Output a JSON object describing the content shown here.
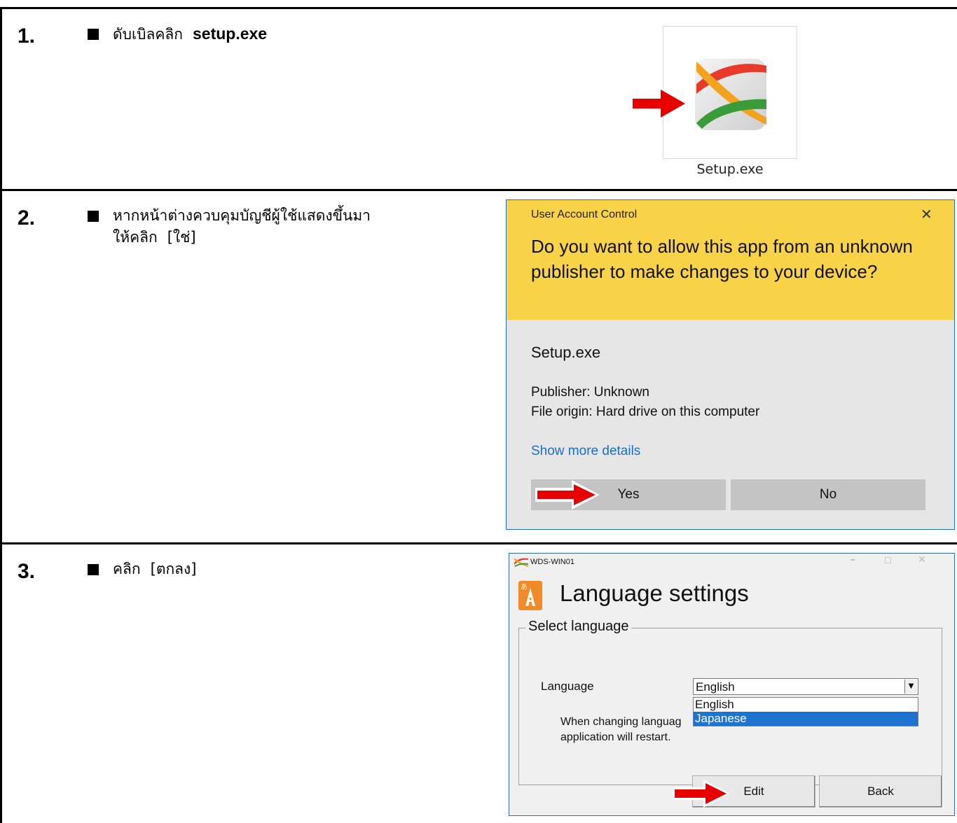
{
  "steps": [
    {
      "number": "1.",
      "text": "ดับเบิลคลิก",
      "emphasis": "setup.exe"
    },
    {
      "number": "2.",
      "text_line1": "หากหน้าต่างควบคุมบัญชีผู้ใช้แสดงขึ้นมา",
      "text_line2": "ให้คลิก",
      "emphasis": "[ใช่]"
    },
    {
      "number": "3.",
      "text": "คลิก",
      "emphasis": "[ตกลง]"
    }
  ],
  "file_icon": {
    "caption": "Setup.exe",
    "icon": "setup-app-icon"
  },
  "uac_dialog": {
    "title": "User Account Control",
    "close": "✕",
    "question": "Do you want to allow this app from an unknown publisher to make changes to your device?",
    "app_name": "Setup.exe",
    "publisher": "Publisher: Unknown",
    "file_origin": "File origin: Hard drive on this computer",
    "more_details": "Show more details",
    "yes_label": "Yes",
    "no_label": "No",
    "header_color": "#f8d247",
    "link_color": "#1b6ecc"
  },
  "language_window": {
    "title": "WDS-WIN01",
    "minimize": "–",
    "maximize": "☐",
    "close": "✕",
    "heading": "Language settings",
    "group_label": "Select language",
    "language_label": "Language",
    "selected_value": "English",
    "options": [
      "English",
      "Japanese"
    ],
    "highlighted_option": "Japanese",
    "note_line1": "When changing languag",
    "note_line2": " application will restart.",
    "edit_label": "Edit",
    "back_label": "Back"
  },
  "arrow_color": "#e60000"
}
